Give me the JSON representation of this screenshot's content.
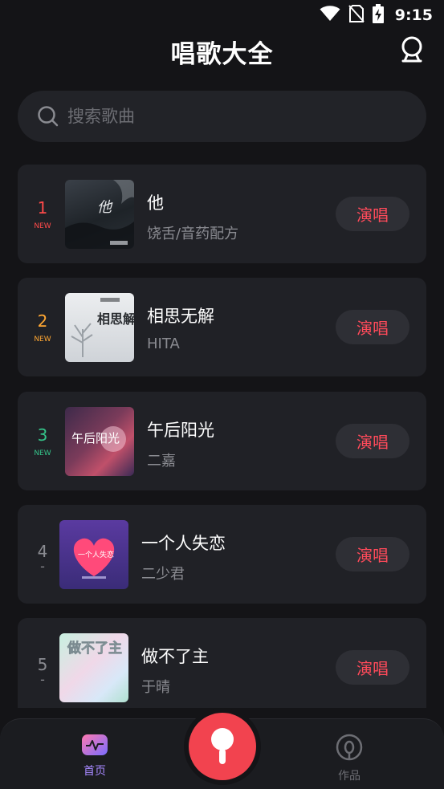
{
  "status_bar": {
    "time": "9:15",
    "icons": [
      "wifi-icon",
      "no-sim-icon",
      "battery-charging-icon"
    ]
  },
  "header": {
    "title": "唱歌大全",
    "user_icon": "user-icon"
  },
  "search": {
    "placeholder": "搜索歌曲",
    "icon": "search-icon"
  },
  "songs": [
    {
      "rank": "1",
      "badge": "NEW",
      "rank_color": "#ff4a4a",
      "title": "他",
      "artist": "饶舌/音药配方",
      "cover_text": "他",
      "action": "演唱"
    },
    {
      "rank": "2",
      "badge": "NEW",
      "rank_color": "#ffa733",
      "title": "相思无解",
      "artist": "HITA",
      "cover_text": "相思解",
      "action": "演唱"
    },
    {
      "rank": "3",
      "badge": "NEW",
      "rank_color": "#35c48a",
      "title": "午后阳光",
      "artist": "二嘉",
      "cover_text": "午后阳光",
      "action": "演唱"
    },
    {
      "rank": "4",
      "badge": "-",
      "rank_color": "#8a8b91",
      "title": "一个人失恋",
      "artist": "二少君",
      "cover_text": "一个人失恋",
      "action": "演唱"
    },
    {
      "rank": "5",
      "badge": "-",
      "rank_color": "#8a8b91",
      "title": "做不了主",
      "artist": "于晴",
      "cover_text": "做不了主",
      "action": "演唱"
    }
  ],
  "tabs": [
    {
      "label": "首页",
      "icon": "home-pulse-icon",
      "active": true
    },
    {
      "label": "作品",
      "icon": "works-icon",
      "active": false
    }
  ],
  "center_action": {
    "icon": "microphone-icon"
  },
  "colors": {
    "background": "#141417",
    "card": "#202126",
    "accent": "#ff4a5a",
    "active_tab": "#a788ff"
  }
}
